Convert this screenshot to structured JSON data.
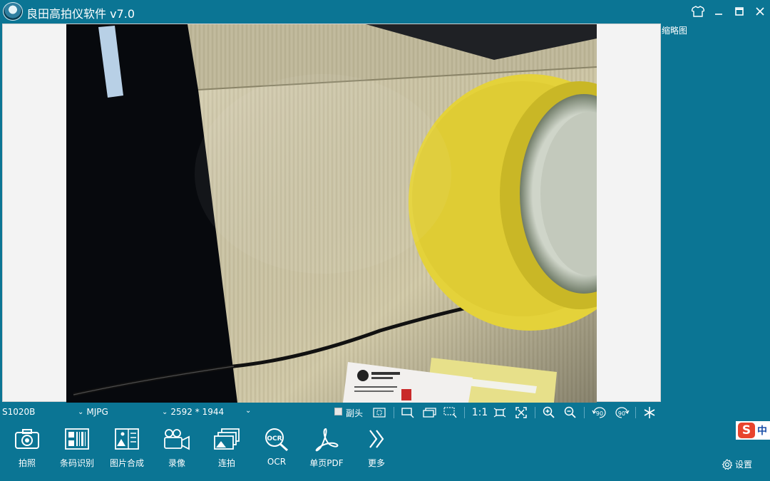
{
  "window": {
    "title": "良田高拍仪软件 v7.0",
    "controls": [
      "skin-icon",
      "minimize-icon",
      "maximize-icon",
      "close-icon"
    ]
  },
  "sidebar": {
    "thumbnail_label": "缩略图"
  },
  "status": {
    "device": "S1020B",
    "format": "MJPG",
    "resolution": "2592 * 1944",
    "sub_camera_label": "副头",
    "ratio_label": "1:1",
    "rotate_left_label": "90",
    "rotate_right_label": "90"
  },
  "toolbar": {
    "items": [
      {
        "label": "拍照",
        "icon": "camera-icon"
      },
      {
        "label": "条码识别",
        "icon": "barcode-icon"
      },
      {
        "label": "图片合成",
        "icon": "image-merge-icon"
      },
      {
        "label": "录像",
        "icon": "video-icon"
      },
      {
        "label": "连拍",
        "icon": "burst-icon"
      },
      {
        "label": "OCR",
        "icon": "ocr-icon"
      },
      {
        "label": "单页PDF",
        "icon": "pdf-icon"
      },
      {
        "label": "更多",
        "icon": "more-icon"
      }
    ]
  },
  "settings": {
    "label": "设置"
  },
  "ime": {
    "label": "中"
  },
  "colors": {
    "chrome": "#0b7594",
    "panel": "#f3f3f3",
    "tape": "#e4d23a"
  }
}
